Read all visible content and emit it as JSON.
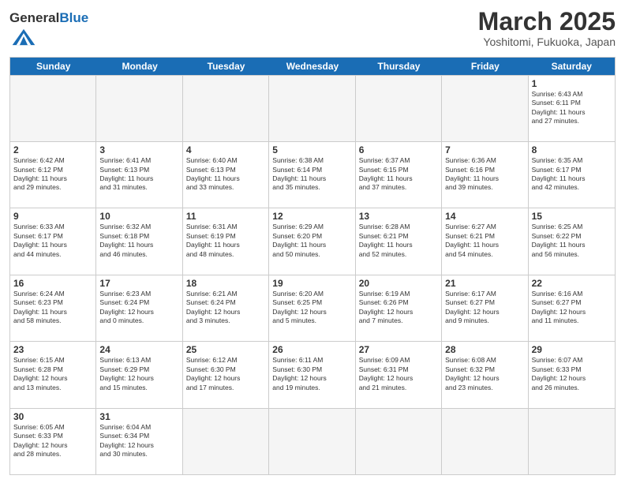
{
  "header": {
    "logo_general": "General",
    "logo_blue": "Blue",
    "month_title": "March 2025",
    "location": "Yoshitomi, Fukuoka, Japan"
  },
  "days_of_week": [
    "Sunday",
    "Monday",
    "Tuesday",
    "Wednesday",
    "Thursday",
    "Friday",
    "Saturday"
  ],
  "weeks": [
    [
      {
        "day": "",
        "info": ""
      },
      {
        "day": "",
        "info": ""
      },
      {
        "day": "",
        "info": ""
      },
      {
        "day": "",
        "info": ""
      },
      {
        "day": "",
        "info": ""
      },
      {
        "day": "",
        "info": ""
      },
      {
        "day": "1",
        "info": "Sunrise: 6:43 AM\nSunset: 6:11 PM\nDaylight: 11 hours\nand 27 minutes."
      }
    ],
    [
      {
        "day": "2",
        "info": "Sunrise: 6:42 AM\nSunset: 6:12 PM\nDaylight: 11 hours\nand 29 minutes."
      },
      {
        "day": "3",
        "info": "Sunrise: 6:41 AM\nSunset: 6:13 PM\nDaylight: 11 hours\nand 31 minutes."
      },
      {
        "day": "4",
        "info": "Sunrise: 6:40 AM\nSunset: 6:13 PM\nDaylight: 11 hours\nand 33 minutes."
      },
      {
        "day": "5",
        "info": "Sunrise: 6:38 AM\nSunset: 6:14 PM\nDaylight: 11 hours\nand 35 minutes."
      },
      {
        "day": "6",
        "info": "Sunrise: 6:37 AM\nSunset: 6:15 PM\nDaylight: 11 hours\nand 37 minutes."
      },
      {
        "day": "7",
        "info": "Sunrise: 6:36 AM\nSunset: 6:16 PM\nDaylight: 11 hours\nand 39 minutes."
      },
      {
        "day": "8",
        "info": "Sunrise: 6:35 AM\nSunset: 6:17 PM\nDaylight: 11 hours\nand 42 minutes."
      }
    ],
    [
      {
        "day": "9",
        "info": "Sunrise: 6:33 AM\nSunset: 6:17 PM\nDaylight: 11 hours\nand 44 minutes."
      },
      {
        "day": "10",
        "info": "Sunrise: 6:32 AM\nSunset: 6:18 PM\nDaylight: 11 hours\nand 46 minutes."
      },
      {
        "day": "11",
        "info": "Sunrise: 6:31 AM\nSunset: 6:19 PM\nDaylight: 11 hours\nand 48 minutes."
      },
      {
        "day": "12",
        "info": "Sunrise: 6:29 AM\nSunset: 6:20 PM\nDaylight: 11 hours\nand 50 minutes."
      },
      {
        "day": "13",
        "info": "Sunrise: 6:28 AM\nSunset: 6:21 PM\nDaylight: 11 hours\nand 52 minutes."
      },
      {
        "day": "14",
        "info": "Sunrise: 6:27 AM\nSunset: 6:21 PM\nDaylight: 11 hours\nand 54 minutes."
      },
      {
        "day": "15",
        "info": "Sunrise: 6:25 AM\nSunset: 6:22 PM\nDaylight: 11 hours\nand 56 minutes."
      }
    ],
    [
      {
        "day": "16",
        "info": "Sunrise: 6:24 AM\nSunset: 6:23 PM\nDaylight: 11 hours\nand 58 minutes."
      },
      {
        "day": "17",
        "info": "Sunrise: 6:23 AM\nSunset: 6:24 PM\nDaylight: 12 hours\nand 0 minutes."
      },
      {
        "day": "18",
        "info": "Sunrise: 6:21 AM\nSunset: 6:24 PM\nDaylight: 12 hours\nand 3 minutes."
      },
      {
        "day": "19",
        "info": "Sunrise: 6:20 AM\nSunset: 6:25 PM\nDaylight: 12 hours\nand 5 minutes."
      },
      {
        "day": "20",
        "info": "Sunrise: 6:19 AM\nSunset: 6:26 PM\nDaylight: 12 hours\nand 7 minutes."
      },
      {
        "day": "21",
        "info": "Sunrise: 6:17 AM\nSunset: 6:27 PM\nDaylight: 12 hours\nand 9 minutes."
      },
      {
        "day": "22",
        "info": "Sunrise: 6:16 AM\nSunset: 6:27 PM\nDaylight: 12 hours\nand 11 minutes."
      }
    ],
    [
      {
        "day": "23",
        "info": "Sunrise: 6:15 AM\nSunset: 6:28 PM\nDaylight: 12 hours\nand 13 minutes."
      },
      {
        "day": "24",
        "info": "Sunrise: 6:13 AM\nSunset: 6:29 PM\nDaylight: 12 hours\nand 15 minutes."
      },
      {
        "day": "25",
        "info": "Sunrise: 6:12 AM\nSunset: 6:30 PM\nDaylight: 12 hours\nand 17 minutes."
      },
      {
        "day": "26",
        "info": "Sunrise: 6:11 AM\nSunset: 6:30 PM\nDaylight: 12 hours\nand 19 minutes."
      },
      {
        "day": "27",
        "info": "Sunrise: 6:09 AM\nSunset: 6:31 PM\nDaylight: 12 hours\nand 21 minutes."
      },
      {
        "day": "28",
        "info": "Sunrise: 6:08 AM\nSunset: 6:32 PM\nDaylight: 12 hours\nand 23 minutes."
      },
      {
        "day": "29",
        "info": "Sunrise: 6:07 AM\nSunset: 6:33 PM\nDaylight: 12 hours\nand 26 minutes."
      }
    ],
    [
      {
        "day": "30",
        "info": "Sunrise: 6:05 AM\nSunset: 6:33 PM\nDaylight: 12 hours\nand 28 minutes."
      },
      {
        "day": "31",
        "info": "Sunrise: 6:04 AM\nSunset: 6:34 PM\nDaylight: 12 hours\nand 30 minutes."
      },
      {
        "day": "",
        "info": ""
      },
      {
        "day": "",
        "info": ""
      },
      {
        "day": "",
        "info": ""
      },
      {
        "day": "",
        "info": ""
      },
      {
        "day": "",
        "info": ""
      }
    ]
  ]
}
